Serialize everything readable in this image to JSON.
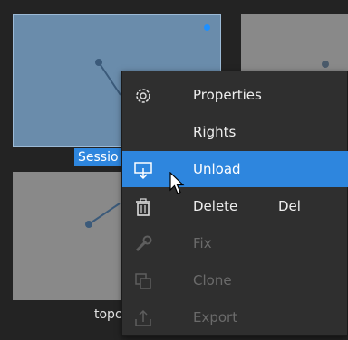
{
  "tiles": {
    "selected": {
      "label": "Sessio"
    },
    "bottom_left": {
      "label": "topo"
    }
  },
  "context_menu": {
    "items": [
      {
        "label": "Properties",
        "shortcut": "",
        "icon": "gear-icon",
        "enabled": true,
        "highlighted": false
      },
      {
        "label": "Rights",
        "shortcut": "",
        "icon": "",
        "enabled": true,
        "highlighted": false
      },
      {
        "label": "Unload",
        "shortcut": "",
        "icon": "unload-icon",
        "enabled": true,
        "highlighted": true
      },
      {
        "label": "Delete",
        "shortcut": "Del",
        "icon": "trash-icon",
        "enabled": true,
        "highlighted": false
      },
      {
        "label": "Fix",
        "shortcut": "",
        "icon": "wrench-icon",
        "enabled": false,
        "highlighted": false
      },
      {
        "label": "Clone",
        "shortcut": "",
        "icon": "clone-icon",
        "enabled": false,
        "highlighted": false
      },
      {
        "label": "Export",
        "shortcut": "",
        "icon": "export-icon",
        "enabled": false,
        "highlighted": false
      }
    ]
  },
  "colors": {
    "accent": "#2e86de",
    "menu_bg": "#2f2f2f",
    "tile_selected": "#6a8cab",
    "tile": "#898989",
    "status_dot": "#1e90ff"
  }
}
